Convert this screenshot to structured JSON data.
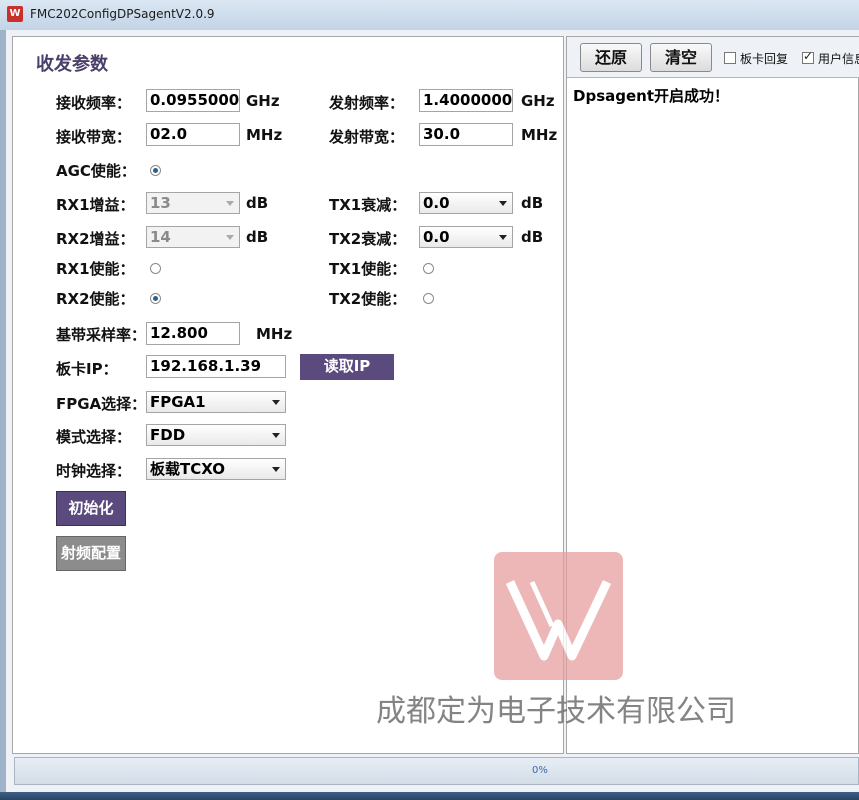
{
  "window": {
    "icon_glyph": "W",
    "title": "FMC202ConfigDPSagentV2.0.9"
  },
  "right": {
    "restore_label": "还原",
    "clear_label": "清空",
    "board_echo_label": "板卡回复",
    "board_echo_checked": false,
    "user_info_label": "用户信息",
    "user_info_checked": true,
    "log_text": "Dpsagent开启成功！"
  },
  "form": {
    "section_title": "收发参数",
    "rx_freq_label": "接收频率：",
    "rx_freq_value": "0.0955000",
    "rx_freq_unit": "GHz",
    "tx_freq_label": "发射频率：",
    "tx_freq_value": "1.4000000",
    "tx_freq_unit": "GHz",
    "rx_bw_label": "接收带宽：",
    "rx_bw_value": "02.0",
    "rx_bw_unit": "MHz",
    "tx_bw_label": "发射带宽：",
    "tx_bw_value": "30.0",
    "tx_bw_unit": "MHz",
    "agc_label": "AGC使能：",
    "agc_on": true,
    "rx1_gain_label": "RX1增益：",
    "rx1_gain_value": "13",
    "rx1_gain_unit": "dB",
    "tx1_att_label": "TX1衰减：",
    "tx1_att_value": "0.0",
    "tx1_att_unit": "dB",
    "rx2_gain_label": "RX2增益：",
    "rx2_gain_value": "14",
    "rx2_gain_unit": "dB",
    "tx2_att_label": "TX2衰减：",
    "tx2_att_value": "0.0",
    "tx2_att_unit": "dB",
    "rx1_en_label": "RX1使能：",
    "rx1_en_on": false,
    "tx1_en_label": "TX1使能：",
    "tx1_en_on": false,
    "rx2_en_label": "RX2使能：",
    "rx2_en_on": true,
    "tx2_en_label": "TX2使能：",
    "tx2_en_on": false,
    "bb_rate_label": "基带采样率：",
    "bb_rate_value": "12.800",
    "bb_rate_unit": "MHz",
    "board_ip_label": "板卡IP：",
    "board_ip_value": "192.168.1.39",
    "read_ip_label": "读取IP",
    "fpga_label": "FPGA选择：",
    "fpga_value": "FPGA1",
    "mode_label": "模式选择：",
    "mode_value": "FDD",
    "clock_label": "时钟选择：",
    "clock_value": "板载TCXO",
    "init_label": "初始化",
    "rf_config_label": "射频配置"
  },
  "status": {
    "progress_text": "0%",
    "progress": 0
  },
  "watermark": {
    "company_text": "成都定为电子技术有限公司"
  },
  "colors": {
    "accent_purple": "#5b4a7e",
    "disabled_gray": "#8c8c8c",
    "watermark_red": "#e7a0a0"
  }
}
